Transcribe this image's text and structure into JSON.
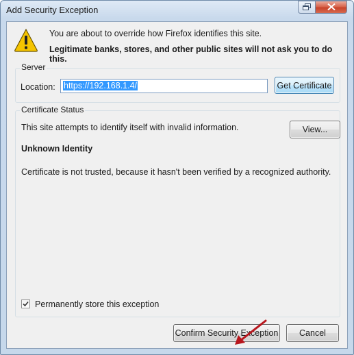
{
  "window": {
    "title": "Add Security Exception"
  },
  "message": {
    "line1": "You are about to override how Firefox identifies this site.",
    "line2": "Legitimate banks, stores, and other public sites will not ask you to do this."
  },
  "server": {
    "legend": "Server",
    "location_label": "Location:",
    "url": "https://192.168.1.4/",
    "get_certificate_label": "Get Certificate"
  },
  "certificate_status": {
    "legend": "Certificate Status",
    "status_text": "This site attempts to identify itself with invalid information.",
    "view_label": "View...",
    "identity_heading": "Unknown Identity",
    "reason_text": "Certificate is not trusted, because it hasn't been verified by a recognized authority."
  },
  "permanent": {
    "label": "Permanently store this exception",
    "checked": true
  },
  "buttons": {
    "confirm_label": "Confirm Security Exception",
    "cancel_label": "Cancel"
  },
  "icons": {
    "warning": "warning-icon",
    "restore": "restore-icon",
    "close": "close-icon",
    "annotation_arrow": "red-arrow"
  },
  "colors": {
    "close_button": "#c8432b",
    "selection": "#3399ff",
    "annotation_arrow": "#b8161d",
    "warning_yellow": "#f5c400"
  }
}
